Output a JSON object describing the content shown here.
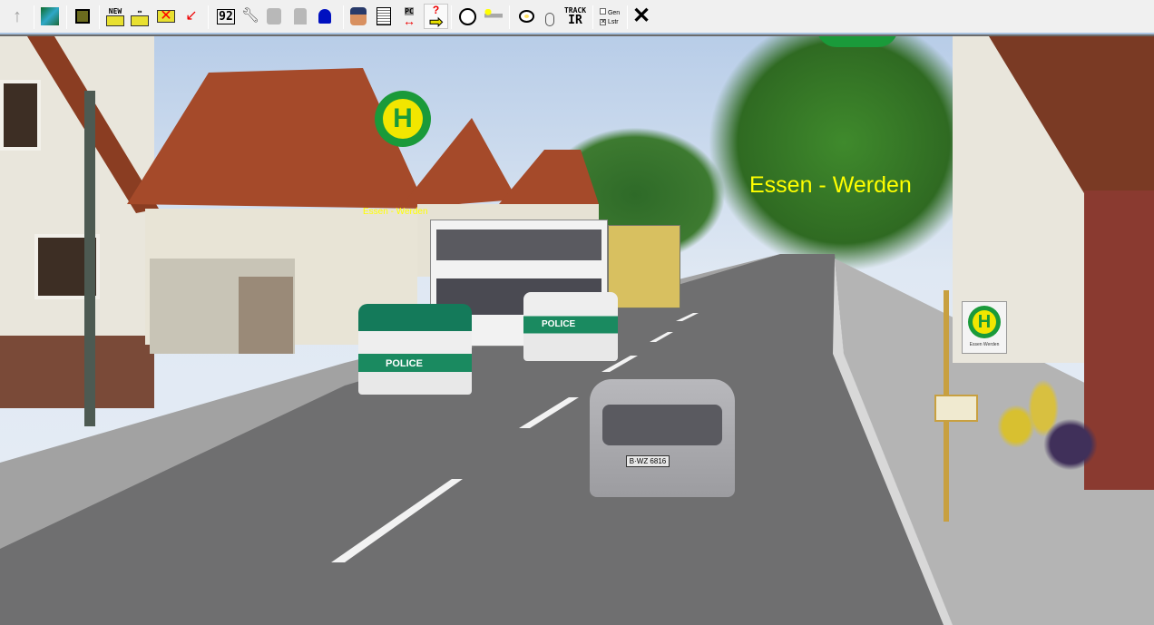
{
  "toolbar": {
    "buttons": [
      {
        "id": "up",
        "icon": "up-arrow-icon",
        "enabled": false
      },
      {
        "id": "map",
        "icon": "map-icon"
      },
      {
        "id": "save",
        "icon": "floppy-disk-icon"
      },
      {
        "id": "new-bus",
        "icon": "new-bus-icon",
        "label": "NEW"
      },
      {
        "id": "change-bus",
        "icon": "change-bus-icon"
      },
      {
        "id": "delete-bus",
        "icon": "delete-bus-icon"
      },
      {
        "id": "place",
        "icon": "place-pin-icon"
      },
      {
        "id": "timetable",
        "icon": "timetable-icon",
        "label": "92"
      },
      {
        "id": "repair",
        "icon": "wrench-icon"
      },
      {
        "id": "ticket",
        "icon": "ticket-printer-icon",
        "enabled": false
      },
      {
        "id": "fuel",
        "icon": "fuel-pump-icon",
        "enabled": false
      },
      {
        "id": "bell",
        "icon": "bell-icon"
      },
      {
        "id": "driver",
        "icon": "driver-icon"
      },
      {
        "id": "list",
        "icon": "list-icon"
      },
      {
        "id": "pc-driver",
        "icon": "pc-driver-swap-icon",
        "label": "PC"
      },
      {
        "id": "help",
        "icon": "help-arrow-icon",
        "pressed": true
      },
      {
        "id": "time",
        "icon": "clock-icon"
      },
      {
        "id": "weather",
        "icon": "weather-icon"
      },
      {
        "id": "steering",
        "icon": "steering-wheel-icon"
      },
      {
        "id": "mouse",
        "icon": "mouse-icon"
      },
      {
        "id": "trackir",
        "icon": "trackir-icon",
        "label_top": "TRACK",
        "label_bottom": "IR"
      },
      {
        "id": "close",
        "icon": "close-icon"
      }
    ],
    "checkboxes": [
      {
        "label": "Gen",
        "checked": false
      },
      {
        "label": "Lstr",
        "checked": true
      }
    ]
  },
  "scene": {
    "stop_label_near": "Essen  -  Werden",
    "stop_label_far": "Essen  -  Werden",
    "police_label": "POLICE",
    "plate": "B·WZ 6816",
    "stop_sign_name": "Essen Werden",
    "stop_sign_glyph": "H",
    "colors": {
      "stop_green": "#1a9a3a",
      "stop_yellow": "#f2e600",
      "label_yellow": "#ffff00"
    }
  }
}
